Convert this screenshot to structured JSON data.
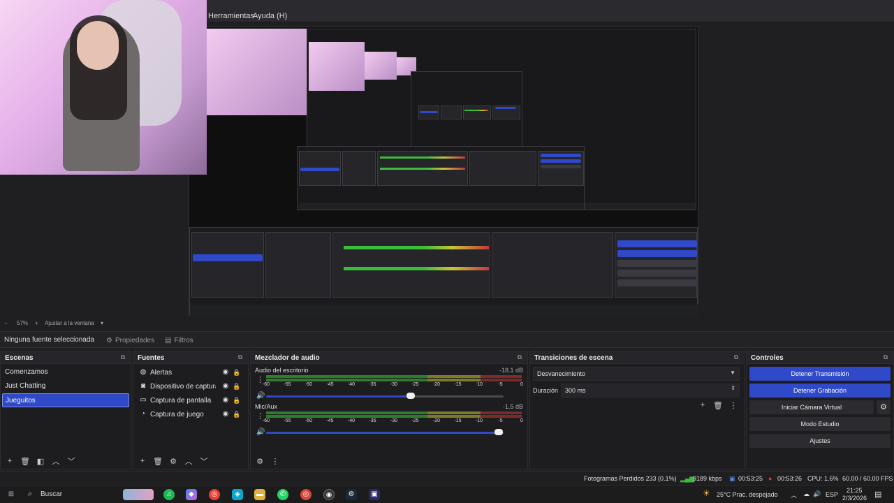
{
  "menu": {
    "items": [
      "Herramientas",
      "Ayuda (H)"
    ]
  },
  "preview": {
    "zoom_label": "57%",
    "fit_label": "Ajustar a la ventana"
  },
  "context": {
    "no_source": "Ninguna fuente seleccionada",
    "properties": "Propiedades",
    "filters": "Filtros"
  },
  "scenes": {
    "title": "Escenas",
    "items": [
      "Comenzamos",
      "Just Chatting",
      "Jueguitos"
    ],
    "selected_index": 2
  },
  "sources": {
    "title": "Fuentes",
    "items": [
      {
        "label": "Alertas",
        "icon": "globe-icon"
      },
      {
        "label": "Dispositivo de captura de vídeo",
        "icon": "camera-icon"
      },
      {
        "label": "Captura de pantalla",
        "icon": "monitor-icon"
      },
      {
        "label": "Captura de juego",
        "icon": "gamepad-icon"
      }
    ]
  },
  "mixer": {
    "title": "Mezclador de audio",
    "channels": [
      {
        "name": "Audio del escritorio",
        "db": "-18.1 dB",
        "volume": 0.61
      },
      {
        "name": "Mic/Aux",
        "db": "-1.5 dB",
        "volume": 0.98
      }
    ],
    "scale": [
      "-60",
      "-55",
      "-50",
      "-45",
      "-40",
      "-35",
      "-30",
      "-25",
      "-20",
      "-15",
      "-10",
      "-5",
      "0"
    ]
  },
  "transitions": {
    "title": "Transiciones de escena",
    "selected": "Desvanecimiento",
    "duration_label": "Duración",
    "duration_value": "300 ms"
  },
  "controls": {
    "title": "Controles",
    "stop_stream": "Detener Transmisión",
    "stop_record": "Detener Grabación",
    "virtual_cam": "Iniciar Cámara Virtual",
    "studio_mode": "Modo Estudio",
    "settings": "Ajustes"
  },
  "status": {
    "dropped": "Fotogramas Perdidos 233 (0.1%)",
    "bitrate": "9189 kbps",
    "stream_time": "00:53:25",
    "rec_time": "00:53:26",
    "cpu": "CPU: 1.6%",
    "fps": "60.00 / 60.00 FPS"
  },
  "taskbar": {
    "search": "Buscar",
    "weather": "25°C  Prac. despejado",
    "lang": "ESP",
    "time": "21:25",
    "date": "2/3/2026"
  },
  "colors": {
    "accent": "#2f49c9",
    "record": "#d23b3b",
    "stream": "#3b6bd2"
  }
}
